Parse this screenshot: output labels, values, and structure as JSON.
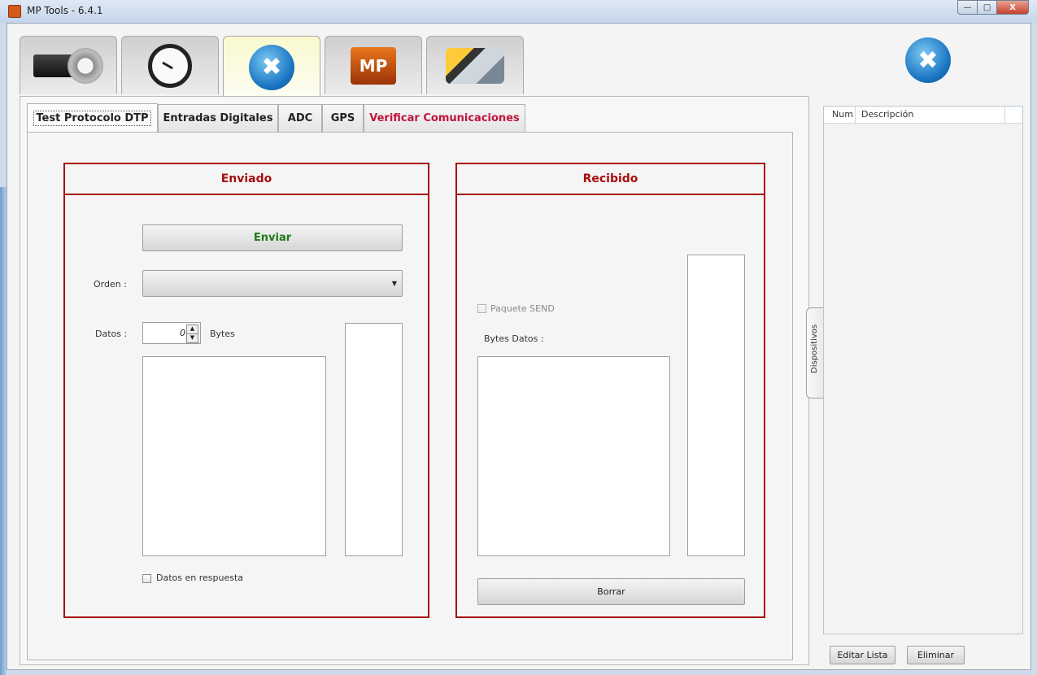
{
  "window": {
    "title": "MP Tools - 6.4.1",
    "close_glyph": "X"
  },
  "top_tabs": [
    {
      "icon": "configuration-gear-icon"
    },
    {
      "icon": "clock-icon"
    },
    {
      "icon": "tools-icon",
      "active": true
    },
    {
      "icon": "mp-tools-icon",
      "text": "MP"
    },
    {
      "icon": "cable-connector-icon"
    }
  ],
  "header_icon": "tools-icon",
  "sub_tabs": [
    {
      "label": "Test Protocolo DTP",
      "active": true
    },
    {
      "label": "Entradas Digitales"
    },
    {
      "label": "ADC"
    },
    {
      "label": "GPS"
    },
    {
      "label": "Verificar Comunicaciones",
      "color": "#c0143c"
    }
  ],
  "enviado": {
    "title": "Enviado",
    "send_button": "Enviar",
    "orden_label": "Orden :",
    "orden_value": "",
    "datos_label": "Datos :",
    "datos_value": "0",
    "bytes_label": "Bytes",
    "datos_en_respuesta": "Datos en respuesta"
  },
  "recibido": {
    "title": "Recibido",
    "paquete_send": "Paquete SEND",
    "bytes_datos_label": "Bytes Datos :",
    "clear_button": "Borrar"
  },
  "side_tab": "Dispositivos",
  "device_list": {
    "columns": [
      "Num",
      "Descripción"
    ],
    "rows": []
  },
  "footer": {
    "edit_button": "Editar Lista",
    "delete_button": "Eliminar"
  },
  "colors": {
    "accent_red": "#a80d0d",
    "send_green": "#1a7a1a",
    "link_red": "#c0143c"
  }
}
